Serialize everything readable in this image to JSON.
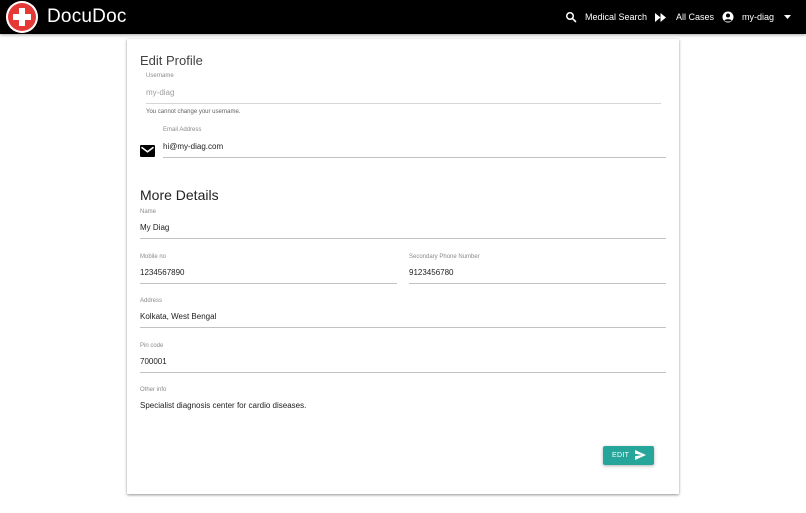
{
  "topbar": {
    "brand": "DocuDoc",
    "search_label": "Medical Search",
    "cases_label": "All Cases",
    "user_label": "my-diag",
    "icons": {
      "logo": "red-cross-logo-icon",
      "search": "search-icon",
      "cases": "fast-forward-icon",
      "user": "account-circle-icon",
      "caret": "caret-down-icon"
    }
  },
  "profile": {
    "title": "Edit Profile",
    "username": {
      "label": "Username",
      "value": "my-diag",
      "helper": "You cannot change your username."
    },
    "email": {
      "label": "Email Address",
      "value": "hi@my-diag.com",
      "icon": "mail-icon"
    }
  },
  "details": {
    "title": "More Details",
    "name": {
      "label": "Name",
      "value": "My Diag"
    },
    "mobile": {
      "label": "Mobile no",
      "value": "1234567890"
    },
    "secondary_phone": {
      "label": "Secondary Phone Number",
      "value": "9123456780"
    },
    "address": {
      "label": "Address",
      "value": "Kolkata, West Bengal"
    },
    "pin": {
      "label": "Pin code",
      "value": "700001"
    },
    "other": {
      "label": "Other info",
      "value": "Specialist diagnosis center for cardio diseases."
    }
  },
  "actions": {
    "edit_label": "EDIT",
    "edit_icon": "send-icon",
    "accent_color": "#26a69a"
  },
  "colors": {
    "topbar": "#000000",
    "logo": "#e53935"
  }
}
